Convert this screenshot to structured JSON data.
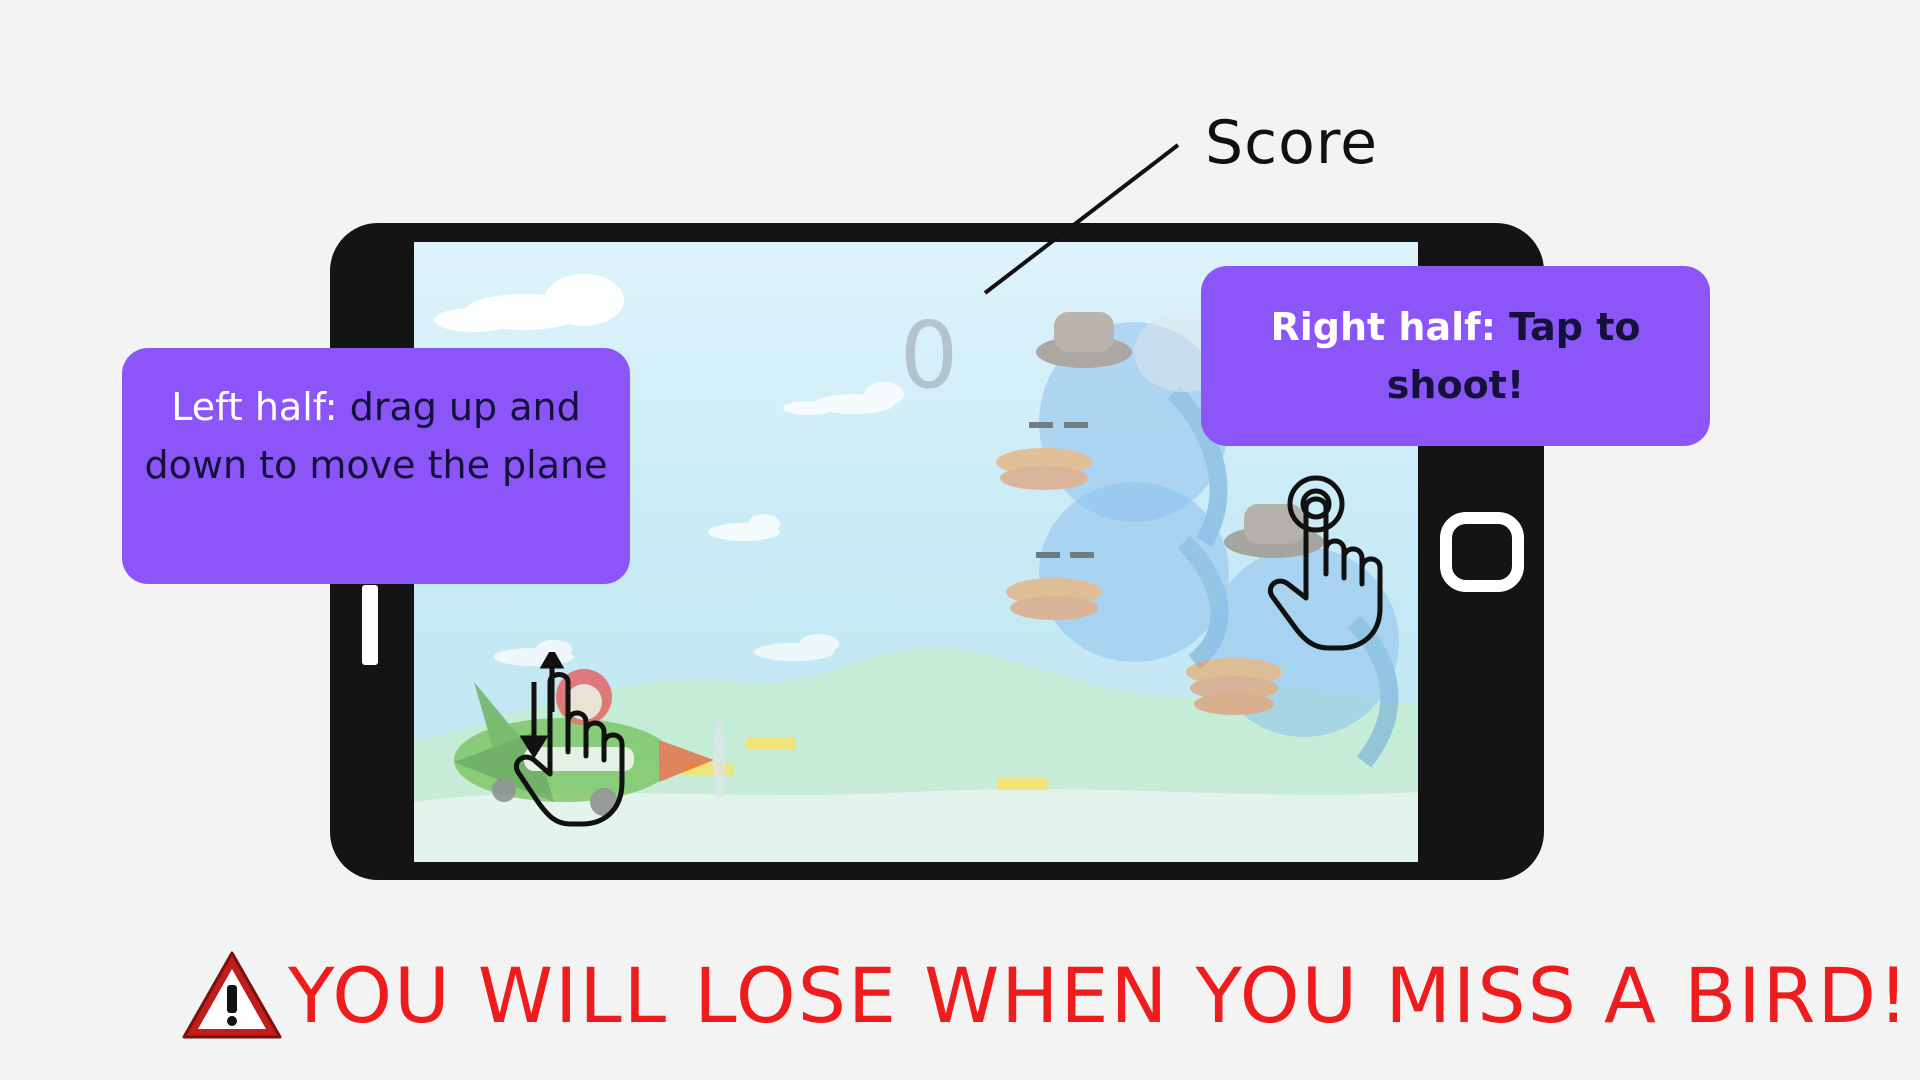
{
  "annotation": {
    "score_label": "Score"
  },
  "game": {
    "score": "0"
  },
  "callouts": {
    "left": {
      "part1": "Left half:",
      "part2": "drag up and down to move the plane"
    },
    "right": {
      "part1": "Right half:",
      "part2": "Tap to shoot!"
    }
  },
  "warning": {
    "text": "YOU WILL LOSE WHEN YOU MISS A BIRD!",
    "icon": "warning-triangle-icon"
  },
  "colors": {
    "callout_bg": "#8b55f7",
    "warning_text": "#ee1c1c",
    "phone_body": "#141414"
  },
  "icons": {
    "drag_gesture": "drag-up-down-hand-icon",
    "tap_gesture": "tap-hand-icon"
  }
}
